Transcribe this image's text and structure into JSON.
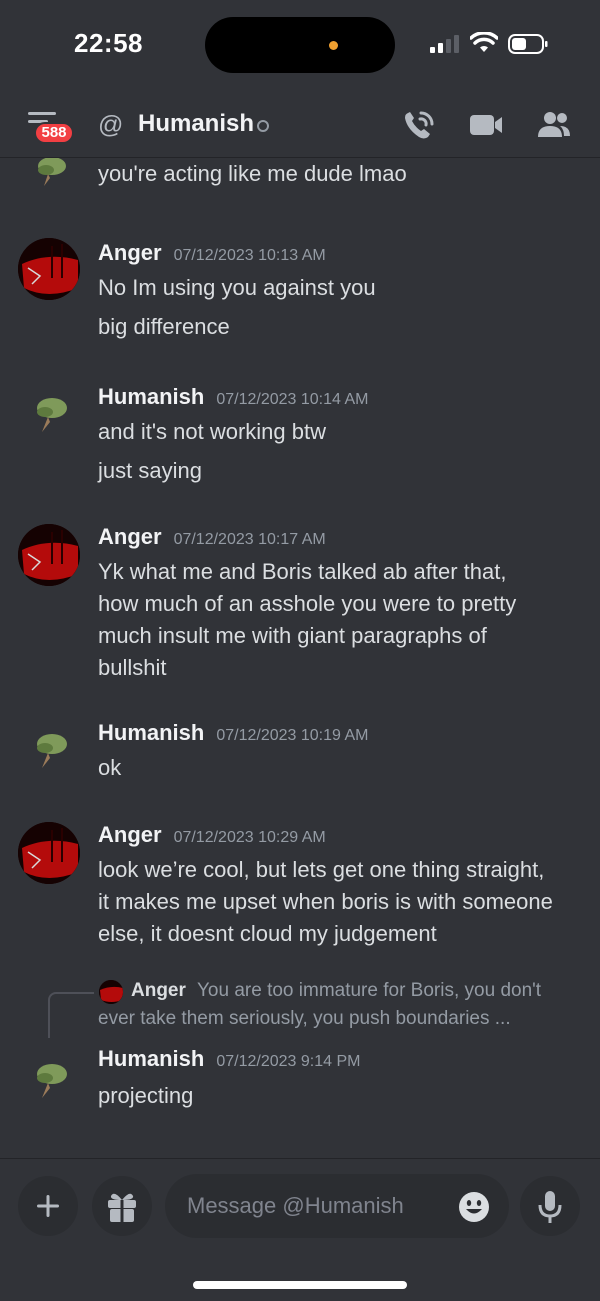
{
  "status_bar": {
    "time": "22:58"
  },
  "header": {
    "unread_badge": "588",
    "at_symbol": "@",
    "dm_name": "Humanish",
    "icons": [
      "menu-icon",
      "at-icon",
      "phone-call-icon",
      "video-icon",
      "members-icon"
    ]
  },
  "messages": [
    {
      "author": "Humanish",
      "timestamp": "",
      "avatar": "frog-avatar",
      "lines": [
        "you're acting like me dude lmao"
      ]
    },
    {
      "author": "Anger",
      "timestamp": "07/12/2023 10:13 AM",
      "avatar": "anger-avatar",
      "lines": [
        "No Im using you against you",
        "big difference"
      ]
    },
    {
      "author": "Humanish",
      "timestamp": "07/12/2023 10:14 AM",
      "avatar": "frog-avatar",
      "lines": [
        "and it's not working btw",
        "just saying"
      ]
    },
    {
      "author": "Anger",
      "timestamp": "07/12/2023 10:17 AM",
      "avatar": "anger-avatar",
      "lines": [
        "Yk what me and Boris talked ab after that,",
        "how much of an asshole you were to pretty",
        "much insult me with giant paragraphs of",
        "bullshit"
      ]
    },
    {
      "author": "Humanish",
      "timestamp": "07/12/2023 10:19 AM",
      "avatar": "frog-avatar",
      "lines": [
        "ok"
      ]
    },
    {
      "author": "Anger",
      "timestamp": "07/12/2023 10:29 AM",
      "avatar": "anger-avatar",
      "lines": [
        "look we’re cool, but lets get one thing straight,",
        "it makes me upset when boris is with someone",
        "else, it doesnt cloud my judgement"
      ]
    },
    {
      "author": "Humanish",
      "timestamp": "07/12/2023 9:14 PM",
      "avatar": "frog-avatar",
      "reply": {
        "author": "Anger",
        "text_line1": "You are too immature for Boris, you don't",
        "text_line2": "ever take them seriously, you push boundaries ..."
      },
      "lines": [
        "projecting"
      ]
    }
  ],
  "composer": {
    "placeholder": "Message @Humanish",
    "icons": [
      "plus-icon",
      "gift-icon",
      "emoji-icon",
      "microphone-icon"
    ]
  },
  "colors": {
    "background": "#313338",
    "badge": "#f23f43",
    "input": "#2b2d31"
  }
}
